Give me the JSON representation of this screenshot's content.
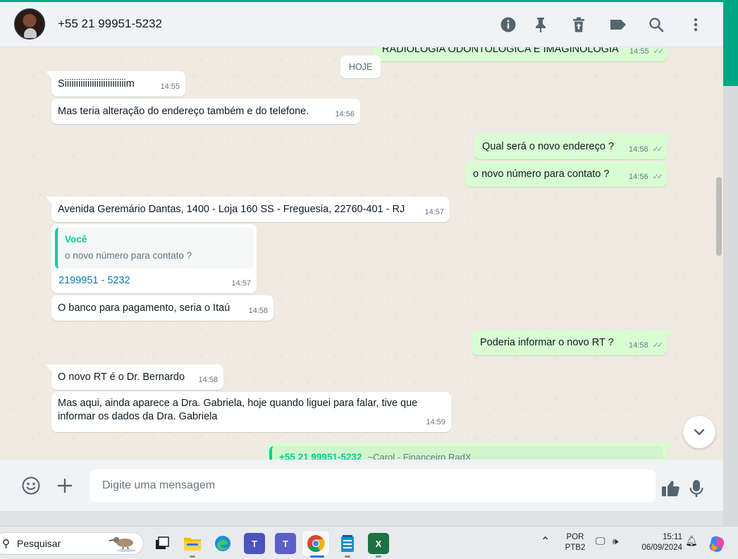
{
  "header": {
    "contact_name": "+55 21 99951-5232",
    "icons": [
      "info-icon",
      "pin-icon",
      "delete-icon",
      "label-icon",
      "search-icon",
      "more-icon"
    ]
  },
  "chat": {
    "partial_top_message": {
      "text": "RADIOLOGIA ODONTOLÓGICA E IMAGINOLOGIA",
      "time": "14:55"
    },
    "day_divider": "HOJE",
    "messages": [
      {
        "dir": "in",
        "text": "Siiiiiiiiiiiiiiiiiiiiiiiiiiim",
        "time": "14:55"
      },
      {
        "dir": "in",
        "text": "Mas teria alteração do endereço também e do telefone.",
        "time": "14:56"
      },
      {
        "dir": "out",
        "text": "Qual será o novo endereço ?",
        "time": "14:56"
      },
      {
        "dir": "out",
        "text": "o novo número para contato ?",
        "time": "14:56"
      },
      {
        "dir": "in",
        "text": "Avenida Geremário Dantas, 1400 - Loja 160 SS - Freguesia, 22760-401 - RJ",
        "time": "14:57"
      },
      {
        "dir": "in",
        "quote_author": "Você",
        "quote_text": "o novo número para contato ?",
        "text": "2199951 - 5232",
        "time": "14:57"
      },
      {
        "dir": "in",
        "text": "O banco para pagamento, seria o Itaú",
        "time": "14:58"
      },
      {
        "dir": "out",
        "text": "Poderia informar o novo RT ?",
        "time": "14:58"
      },
      {
        "dir": "in",
        "text": "O novo RT é o Dr. Bernardo",
        "time": "14:58"
      },
      {
        "dir": "in",
        "text": "Mas aqui, ainda aparece a Dra. Gabriela, hoje quando liguei para falar, tive que informar os dados da Dra. Gabriela",
        "time": "14:59"
      },
      {
        "dir": "out",
        "quote_author": "+55 21 99951-5232",
        "quote_sub": "~Carol - Financeiro RadX"
      }
    ]
  },
  "composer": {
    "placeholder": "Digite uma mensagem",
    "icons": [
      "emoji-icon",
      "attach-plus-icon",
      "thumbs-up-icon",
      "microphone-icon"
    ]
  },
  "taskbar": {
    "search_label": "Pesquisar",
    "language": "POR",
    "keyboard": "PTB2",
    "time": "15:11",
    "date": "06/09/2024",
    "apps": [
      "task-view",
      "file-explorer",
      "edge",
      "teams-classic",
      "teams",
      "chrome",
      "notepad",
      "excel"
    ]
  },
  "colors": {
    "accent": "#00a884",
    "incoming_bubble": "#ffffff",
    "outgoing_bubble": "#d9fdd3",
    "quote_author": "#06cf9c",
    "link": "#027eb5"
  }
}
